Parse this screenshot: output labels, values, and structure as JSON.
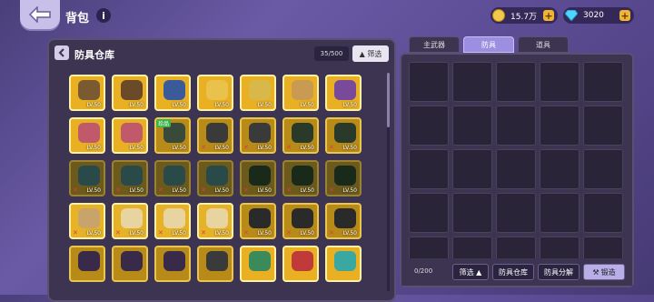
{
  "header": {
    "title": "背包",
    "info": "i",
    "gold": "15.7万",
    "gems": "3020",
    "plus": "+"
  },
  "colors": {
    "background": "#5b4b93",
    "slot_gold": "#e9b023",
    "slot_dark": "#6b5a1c",
    "unusable_mark": "#e83a3a"
  },
  "left_panel": {
    "title": "防具仓库",
    "count": "35/500",
    "filter": "▲ 筛选",
    "scroll_fraction": 0.25,
    "items": [
      {
        "style": "gold",
        "color": "#7a5a30",
        "lv": "LV.50",
        "x": false,
        "tag": ""
      },
      {
        "style": "gold",
        "color": "#6b4a2a",
        "lv": "LV.50",
        "x": false,
        "tag": ""
      },
      {
        "style": "gold",
        "color": "#3a5a9a",
        "lv": "LV.50",
        "x": false,
        "tag": ""
      },
      {
        "style": "gold",
        "color": "#e8c24a",
        "lv": "LV.50",
        "x": false,
        "tag": ""
      },
      {
        "style": "gold",
        "color": "#d9b84a",
        "lv": "LV.50",
        "x": false,
        "tag": ""
      },
      {
        "style": "gold",
        "color": "#c99a52",
        "lv": "LV.50",
        "x": false,
        "tag": ""
      },
      {
        "style": "gold",
        "color": "#7a4a9a",
        "lv": "LV.50",
        "x": false,
        "tag": ""
      },
      {
        "style": "gold",
        "color": "#c05a6a",
        "lv": "LV.50",
        "x": false,
        "tag": ""
      },
      {
        "style": "gold",
        "color": "#c05a6a",
        "lv": "LV.50",
        "x": false,
        "tag": ""
      },
      {
        "style": "dgold",
        "color": "#3a4a3a",
        "lv": "LV.50",
        "x": false,
        "tag": "珍品"
      },
      {
        "style": "dgold",
        "color": "#3a3a3a",
        "lv": "LV.50",
        "x": true,
        "tag": ""
      },
      {
        "style": "dgold",
        "color": "#3a3a3a",
        "lv": "LV.50",
        "x": true,
        "tag": ""
      },
      {
        "style": "dgold",
        "color": "#2a3a2a",
        "lv": "LV.50",
        "x": true,
        "tag": ""
      },
      {
        "style": "dgold",
        "color": "#2a3a2a",
        "lv": "LV.50",
        "x": true,
        "tag": ""
      },
      {
        "style": "dark",
        "color": "#2a4a4a",
        "lv": "LV.50",
        "x": true,
        "tag": ""
      },
      {
        "style": "dark",
        "color": "#2a4a4a",
        "lv": "LV.50",
        "x": true,
        "tag": ""
      },
      {
        "style": "dark",
        "color": "#2a4a4a",
        "lv": "LV.50",
        "x": true,
        "tag": ""
      },
      {
        "style": "dark",
        "color": "#2a4a4a",
        "lv": "LV.50",
        "x": true,
        "tag": ""
      },
      {
        "style": "dark",
        "color": "#1a2a1a",
        "lv": "LV.50",
        "x": true,
        "tag": ""
      },
      {
        "style": "dark",
        "color": "#1a2a1a",
        "lv": "LV.50",
        "x": true,
        "tag": ""
      },
      {
        "style": "dark",
        "color": "#1a2a1a",
        "lv": "LV.50",
        "x": true,
        "tag": ""
      },
      {
        "style": "cream",
        "color": "#c8a46a",
        "lv": "LV.50",
        "x": true,
        "tag": ""
      },
      {
        "style": "cream",
        "color": "#e8d4a0",
        "lv": "LV.50",
        "x": true,
        "tag": ""
      },
      {
        "style": "cream",
        "color": "#e8d4a0",
        "lv": "LV.50",
        "x": true,
        "tag": ""
      },
      {
        "style": "cream",
        "color": "#e8d4a0",
        "lv": "LV.50",
        "x": true,
        "tag": ""
      },
      {
        "style": "dgold",
        "color": "#2a2a2a",
        "lv": "LV.50",
        "x": true,
        "tag": ""
      },
      {
        "style": "dgold",
        "color": "#2a2a2a",
        "lv": "LV.50",
        "x": true,
        "tag": ""
      },
      {
        "style": "dgold",
        "color": "#2a2a2a",
        "lv": "LV.50",
        "x": true,
        "tag": ""
      },
      {
        "style": "dgold",
        "color": "#3a2a4a",
        "lv": "",
        "x": false,
        "tag": ""
      },
      {
        "style": "dgold",
        "color": "#3a2a4a",
        "lv": "",
        "x": false,
        "tag": ""
      },
      {
        "style": "dgold",
        "color": "#3a2a4a",
        "lv": "",
        "x": false,
        "tag": ""
      },
      {
        "style": "dgold",
        "color": "#3a3a3a",
        "lv": "",
        "x": false,
        "tag": ""
      },
      {
        "style": "gold",
        "color": "#3a8a5a",
        "lv": "",
        "x": false,
        "tag": ""
      },
      {
        "style": "gold",
        "color": "#c03a3a",
        "lv": "",
        "x": false,
        "tag": ""
      },
      {
        "style": "gold",
        "color": "#3aa8a0",
        "lv": "",
        "x": false,
        "tag": ""
      }
    ]
  },
  "right_panel": {
    "tabs": [
      {
        "label": "主武器",
        "active": false
      },
      {
        "label": "防具",
        "active": true
      },
      {
        "label": "道具",
        "active": false
      }
    ],
    "slot_count": 25,
    "count": "0/200",
    "filter": "筛选 ▲",
    "armor_warehouse": "防具仓库",
    "armor_decompose": "防具分解",
    "forge": "锻造"
  }
}
